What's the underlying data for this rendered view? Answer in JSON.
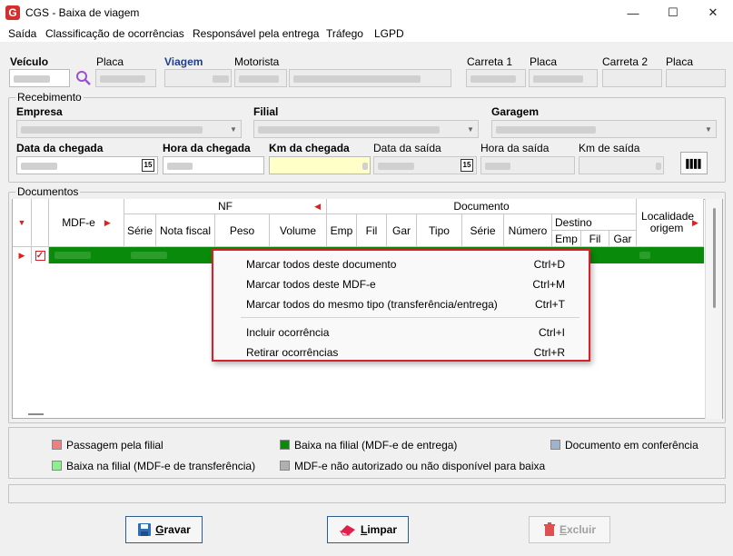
{
  "window": {
    "title": "CGS - Baixa de viagem",
    "minimize": "—",
    "maximize": "☐",
    "close": "✕",
    "logo": "G"
  },
  "menu": [
    "Saída",
    "Classificação de ocorrências",
    "Responsável pela entrega",
    "Tráfego",
    "LGPD"
  ],
  "vehicle": {
    "veiculo_label": "Veículo",
    "placa_label": "Placa",
    "viagem_label": "Viagem",
    "motorista_label": "Motorista",
    "carreta1_label": "Carreta 1",
    "placa1_label": "Placa",
    "carreta2_label": "Carreta 2",
    "placa2_label": "Placa"
  },
  "recebimento": {
    "legend": "Recebimento",
    "empresa_label": "Empresa",
    "filial_label": "Filial",
    "garagem_label": "Garagem",
    "data_chegada_label": "Data da chegada",
    "hora_chegada_label": "Hora da chegada",
    "km_chegada_label": "Km da chegada",
    "data_saida_label": "Data da saída",
    "hora_saida_label": "Hora da saída",
    "km_saida_label": "Km de saída",
    "calendar_glyph": "15",
    "barcode_glyph": "▌▌▌▌"
  },
  "documentos": {
    "legend": "Documentos",
    "headers": {
      "mdfe": "MDF-e",
      "nf": "NF",
      "documento": "Documento",
      "destino": "Destino",
      "nf_cols": [
        "Série",
        "Nota fiscal",
        "Peso",
        "Volume"
      ],
      "doc_cols": [
        "Emp",
        "Fil",
        "Gar",
        "Tipo",
        "Série",
        "Número"
      ],
      "dest_cols": [
        "Emp",
        "Fil",
        "Gar"
      ],
      "localidade": "Localidade origem"
    },
    "row_checked": "✓"
  },
  "context_menu": {
    "items": [
      {
        "label": "Marcar todos deste documento",
        "shortcut": "Ctrl+D"
      },
      {
        "label": "Marcar todos deste MDF-e",
        "shortcut": "Ctrl+M"
      },
      {
        "label": "Marcar todos do mesmo tipo (transferência/entrega)",
        "shortcut": "Ctrl+T"
      },
      {
        "label": "Incluir ocorrência",
        "shortcut": "Ctrl+I"
      },
      {
        "label": "Retirar ocorrências",
        "shortcut": "Ctrl+R"
      }
    ]
  },
  "legend": {
    "items": [
      {
        "label": "Passagem pela filial",
        "color": "#f08080"
      },
      {
        "label": "Baixa na filial (MDF-e de entrega)",
        "color": "#0a8a0a"
      },
      {
        "label": "Documento em conferência",
        "color": "#9fb3cc"
      },
      {
        "label": "Baixa na filial (MDF-e de transferência)",
        "color": "#90ee90"
      },
      {
        "label": "MDF-e não autorizado ou não disponível para baixa",
        "color": "#b0b0b0"
      }
    ]
  },
  "buttons": {
    "gravar": {
      "first": "G",
      "rest": "ravar"
    },
    "limpar": {
      "first": "L",
      "rest": "impar"
    },
    "excluir": {
      "first": "E",
      "rest": "xcluir"
    }
  },
  "colors": {
    "accent": "#1f3f8f",
    "row_green": "#0a8a0a",
    "highlight_red": "#d9202a"
  }
}
